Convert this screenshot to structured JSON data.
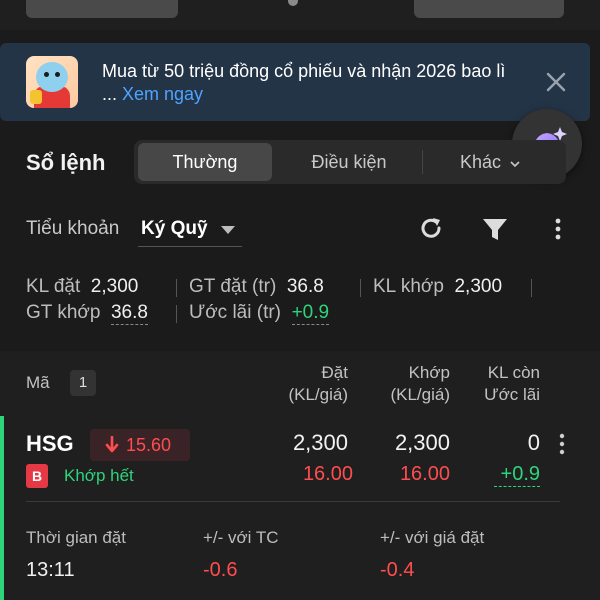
{
  "banner": {
    "line1": "Mua từ 50 triệu đồng cổ phiếu và nhận 2026 bao lì",
    "line2_prefix": "... ",
    "link": "Xem ngay"
  },
  "header": {
    "title": "Sổ lệnh",
    "tabs": [
      "Thường",
      "Điều kiện",
      "Khác"
    ]
  },
  "subaccount": {
    "label": "Tiểu khoản",
    "value": "Ký Quỹ"
  },
  "stats": {
    "kl_dat_label": "KL đặt",
    "kl_dat": "2,300",
    "gt_dat_label": "GT đặt (tr)",
    "gt_dat": "36.8",
    "kl_khop_label": "KL khớp",
    "kl_khop": "2,300",
    "gt_khop_label": "GT khớp",
    "gt_khop": "36.8",
    "uoc_lai_label": "Ước lãi (tr)",
    "uoc_lai": "+0.9"
  },
  "table": {
    "col_ma": "Mã",
    "count": "1",
    "col_dat_1": "Đặt",
    "col_dat_2": "(KL/giá)",
    "col_khop_1": "Khớp",
    "col_khop_2": "(KL/giá)",
    "col_klcon_1": "KL còn",
    "col_klcon_2": "Ước lãi",
    "rows": [
      {
        "symbol": "HSG",
        "price": "15.60",
        "side": "B",
        "status": "Khớp hết",
        "dat_kl": "2,300",
        "dat_gia": "16.00",
        "khop_kl": "2,300",
        "khop_gia": "16.00",
        "kl_con": "0",
        "uoc_lai": "+0.9",
        "thoi_gian_label": "Thời gian đặt",
        "thoi_gian": "13:11",
        "vs_tc_label": "+/- với TC",
        "vs_tc": "-0.6",
        "vs_gia_dat_label": "+/- với giá đặt",
        "vs_gia_dat": "-0.4"
      }
    ]
  },
  "colors": {
    "up": "#2ed47a",
    "down": "#ff4d4f",
    "link": "#4fa3ff",
    "banner_bg": "#243447"
  },
  "icons": [
    "close-icon",
    "refresh-icon",
    "filter-icon",
    "more-vertical-icon",
    "chevron-down-icon",
    "arrow-down-icon",
    "ai-assistant-icon"
  ]
}
